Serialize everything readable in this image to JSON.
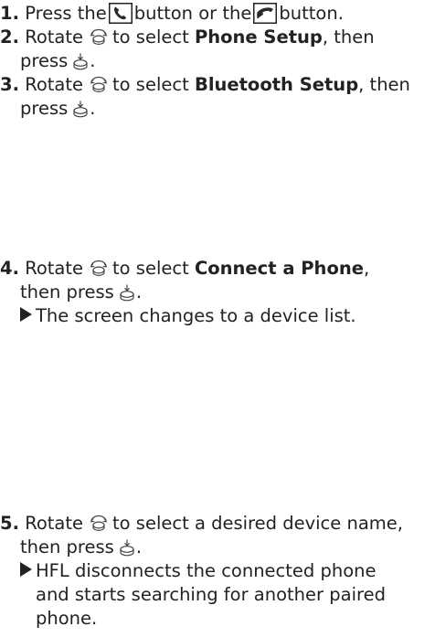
{
  "steps": {
    "s1": {
      "num": "1.",
      "t1": "Press the",
      "t2": "button or the",
      "t3": "button."
    },
    "s2": {
      "num": "2.",
      "t1": "Rotate",
      "t2": "to select",
      "bold": "Phone Setup",
      "t3": ", then",
      "t4": "press",
      "t5": "."
    },
    "s3": {
      "num": "3.",
      "t1": "Rotate",
      "t2": "to select",
      "bold": "Bluetooth Setup",
      "t3": ", then",
      "t4": "press",
      "t5": "."
    },
    "s4": {
      "num": "4.",
      "t1": "Rotate",
      "t2": "to select",
      "bold": "Connect a Phone",
      "t3": ",",
      "t4": "then press",
      "t5": ".",
      "result": "The screen changes to a device list."
    },
    "s5": {
      "num": "5.",
      "t1": "Rotate",
      "t2": "to select a desired device name,",
      "t4": "then press",
      "t5": ".",
      "result1": "HFL disconnects the connected phone",
      "result2": "and starts searching for another paired",
      "result3": "phone."
    }
  },
  "icons": {
    "phone": "phone-icon",
    "pickup": "pickup-icon",
    "knob": "selector-knob-icon",
    "press": "press-knob-icon"
  }
}
